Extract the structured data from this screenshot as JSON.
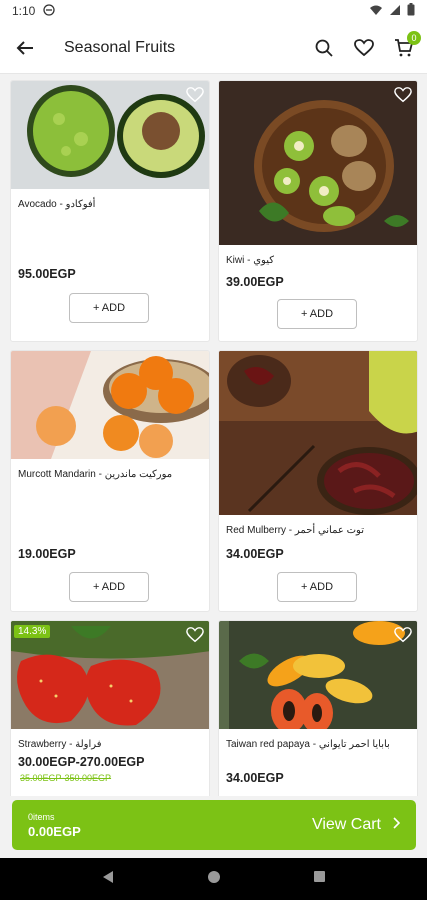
{
  "status": {
    "time": "1:10"
  },
  "header": {
    "title": "Seasonal Fruits",
    "cart_count": "0"
  },
  "products": [
    {
      "name": "Avocado - أفوكادو",
      "price": "95.00EGP",
      "add": "+ ADD"
    },
    {
      "name": "Kiwi - كيوي",
      "price": "39.00EGP",
      "add": "+ ADD"
    },
    {
      "name": "Murcott Mandarin - موركيت ماندرين",
      "price": "19.00EGP",
      "add": "+ ADD"
    },
    {
      "name": "Red Mulberry - توت عماني أحمر",
      "price": "34.00EGP",
      "add": "+ ADD"
    },
    {
      "name": "Strawberry - فراولة",
      "price": "30.00EGP-270.00EGP",
      "old_price": "35.00EGP-350.00EGP",
      "discount": "14.3%"
    },
    {
      "name": "Taiwan red papaya - بابايا احمر تايواني",
      "price": "34.00EGP"
    }
  ],
  "cart": {
    "items": "0items",
    "total": "0.00EGP",
    "view_label": "View Cart"
  },
  "colors": {
    "accent": "#7cc215"
  }
}
